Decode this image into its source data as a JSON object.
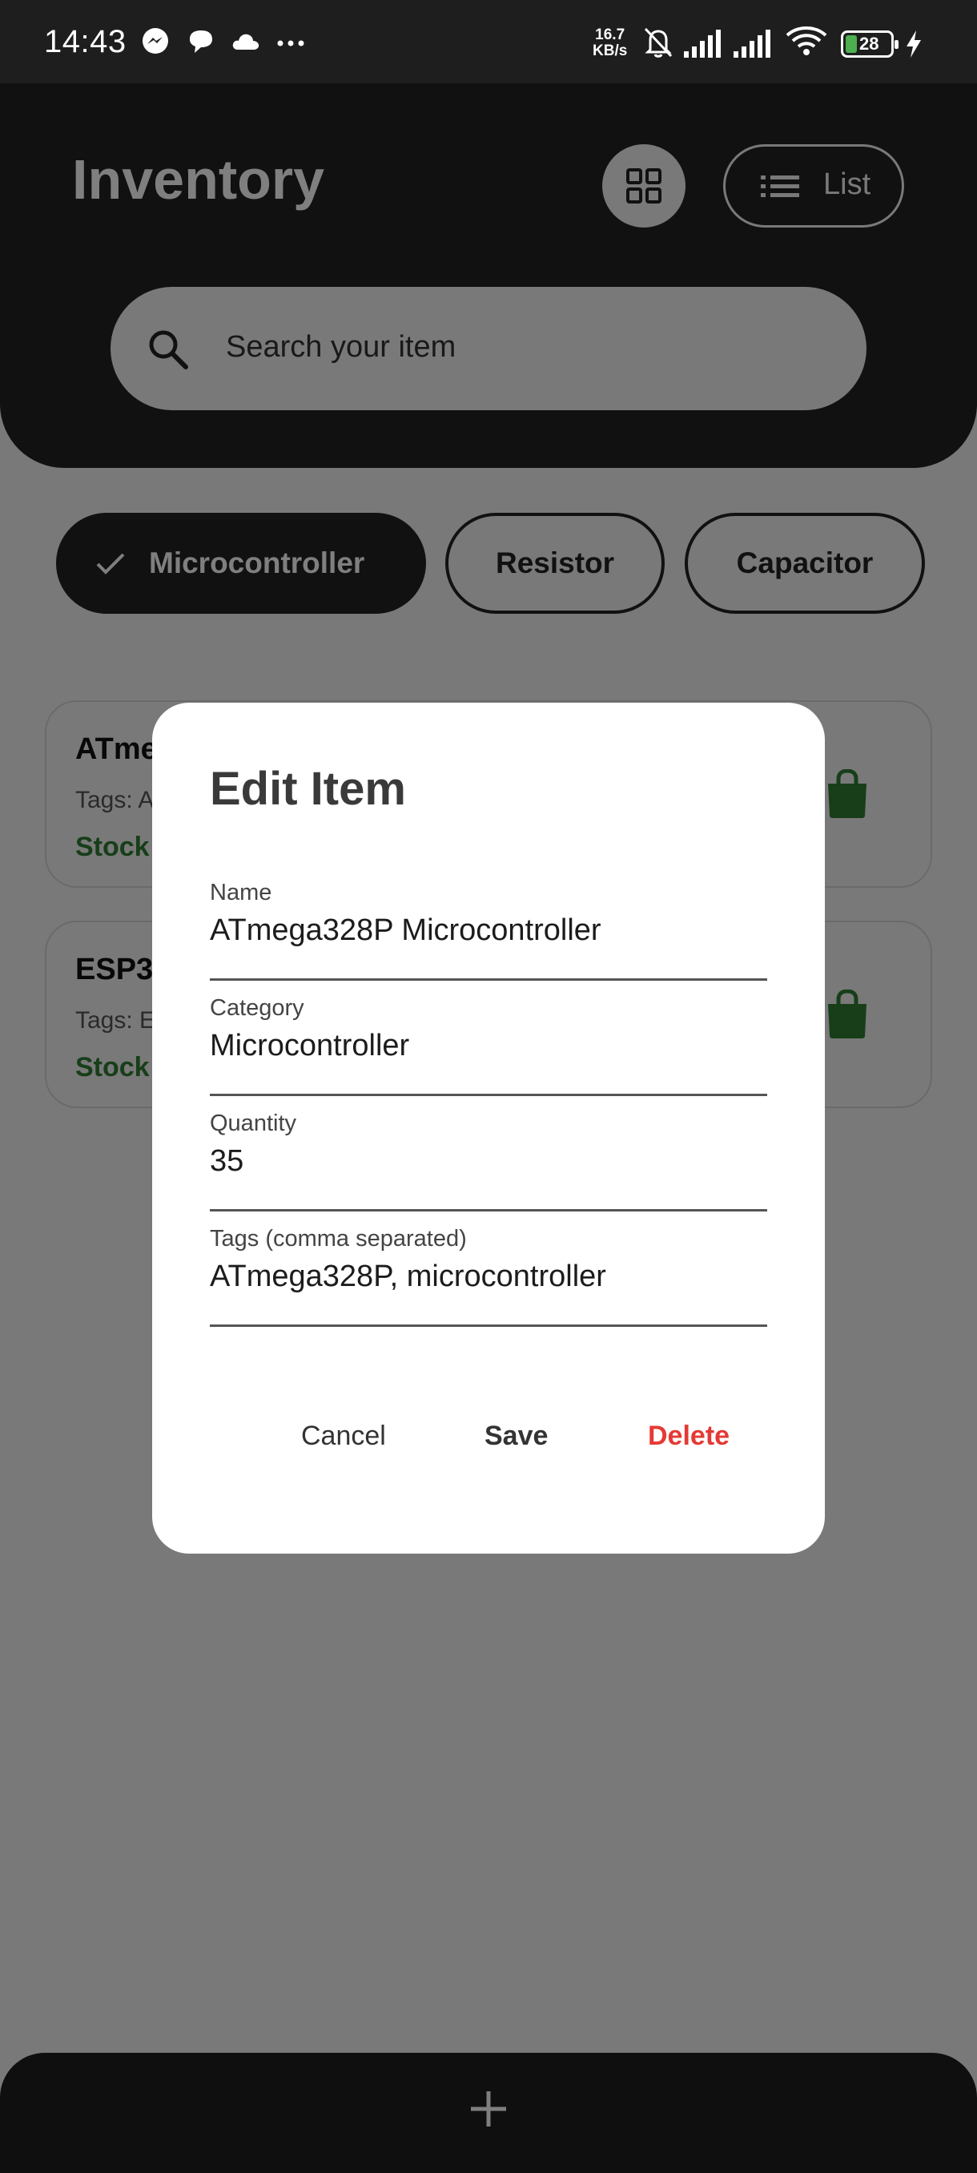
{
  "status_bar": {
    "time": "14:43",
    "speed_value": "16.7",
    "speed_unit": "KB/s",
    "battery": "28",
    "notification_icons": [
      "messenger-icon",
      "chat-icon",
      "cloud-icon",
      "more-dots-icon"
    ],
    "system_icons": [
      "bell-off-icon",
      "signal-icon",
      "signal-icon",
      "wifi-icon",
      "battery-icon",
      "charging-icon"
    ]
  },
  "header": {
    "title": "Inventory",
    "grid_icon": "grid-view-icon",
    "list_button_label": "List",
    "list_icon": "list-icon",
    "search_placeholder": "Search your item",
    "search_icon": "search-icon"
  },
  "chips": [
    {
      "label": "Microcontroller",
      "selected": true
    },
    {
      "label": "Resistor",
      "selected": false
    },
    {
      "label": "Capacitor",
      "selected": false
    }
  ],
  "items": [
    {
      "title": "ATme",
      "tags": "Tags: A",
      "stock": "Stock"
    },
    {
      "title": "ESP3",
      "tags": "Tags: E",
      "stock": "Stock"
    }
  ],
  "dialog": {
    "title": "Edit Item",
    "fields": [
      {
        "label": "Name",
        "value": "ATmega328P Microcontroller"
      },
      {
        "label": "Category",
        "value": "Microcontroller"
      },
      {
        "label": "Quantity",
        "value": "35"
      },
      {
        "label": "Tags (comma separated)",
        "value": "ATmega328P, microcontroller"
      }
    ],
    "cancel_label": "Cancel",
    "save_label": "Save",
    "delete_label": "Delete"
  },
  "bottom_bar": {
    "add_icon": "plus-icon"
  },
  "colors": {
    "dark": "#232323",
    "background": "#f2f2f2",
    "stock_green": "#2e7d32",
    "delete_red": "#e53935",
    "scrim": "rgba(0,0,0,0.5)"
  }
}
